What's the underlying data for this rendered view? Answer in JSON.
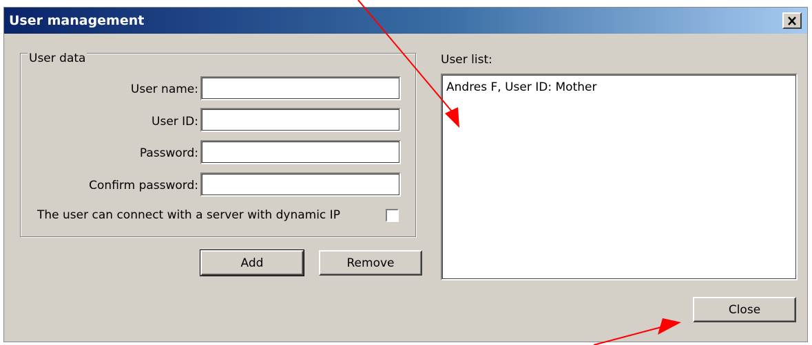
{
  "window": {
    "title": "User management",
    "close_glyph": "×"
  },
  "user_data": {
    "legend": "User data",
    "user_name_label": "User name:",
    "user_name_value": "",
    "user_id_label": "User ID:",
    "user_id_value": "",
    "password_label": "Password:",
    "password_value": "",
    "confirm_password_label": "Confirm password:",
    "confirm_password_value": "",
    "dynamic_ip_label": "The user can connect with a server with dynamic IP",
    "dynamic_ip_checked": false
  },
  "buttons": {
    "add": "Add",
    "remove": "Remove",
    "close": "Close"
  },
  "user_list": {
    "label": "User list:",
    "items": [
      "Andres F, User ID: Mother"
    ]
  },
  "annotations": {
    "arrow_color": "#ff0000"
  }
}
